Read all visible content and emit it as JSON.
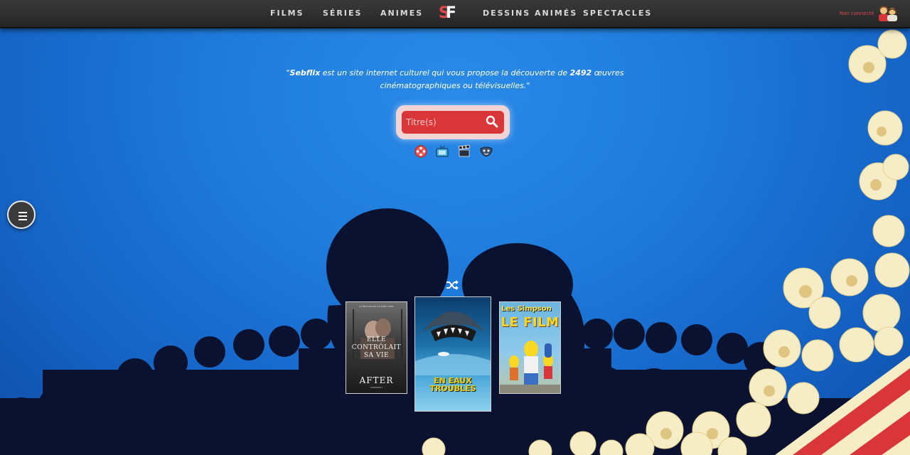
{
  "nav": {
    "films": "FILMS",
    "series": "SÉRIES",
    "animes": "ANIMES",
    "logo_s": "S",
    "logo_f": "F",
    "dessins": "DESSINS ANIMÉS",
    "spectacles": "SPECTACLES",
    "status": "Non connecté"
  },
  "tagline": {
    "open": "\"",
    "site": "Sebflix",
    "part1": " est un site internet culturel qui vous propose la découverte de ",
    "count": "2492",
    "part2": " œuvres cinématographiques ou télévisuelles.\""
  },
  "search": {
    "placeholder": "Titre(s)"
  },
  "categories": [
    {
      "icon": "film-reel-icon"
    },
    {
      "icon": "tv-icon"
    },
    {
      "icon": "clapper-icon"
    },
    {
      "icon": "mask-icon"
    }
  ],
  "posters": {
    "after": {
      "top": "LE BEST-SELLER DE ANNA TODD",
      "tagline": "ELLE CONTRÔLAIT SA VIE",
      "title": "AFTER",
      "bottom": "CHAPITRE 1"
    },
    "meg": {
      "title": "EN EAUX TROUBLES"
    },
    "simpsons": {
      "logo": "Les Simpson",
      "title": "LE FILM"
    }
  },
  "colors": {
    "accent_red": "#d9363a",
    "nav_bg": "#2e2e2e",
    "sky_blue": "#1f7cdc",
    "silhouette": "#0a1230",
    "popcorn": "#f6ecc6"
  }
}
